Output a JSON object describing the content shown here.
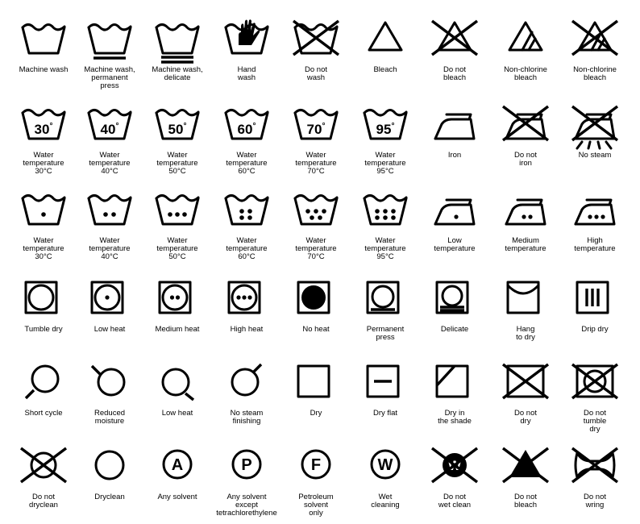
{
  "symbols": [
    {
      "icon": "machine-wash-icon",
      "label": "Machine wash"
    },
    {
      "icon": "machine-wash-permanent-press-icon",
      "label": "Machine wash,\npermanent\npress"
    },
    {
      "icon": "machine-wash-delicate-icon",
      "label": "Machine wash,\ndelicate"
    },
    {
      "icon": "hand-wash-icon",
      "label": "Hand\nwash"
    },
    {
      "icon": "do-not-wash-icon",
      "label": "Do not\nwash"
    },
    {
      "icon": "bleach-icon",
      "label": "Bleach"
    },
    {
      "icon": "do-not-bleach-icon",
      "label": "Do not\nbleach"
    },
    {
      "icon": "non-chlorine-bleach-icon",
      "label": "Non-chlorine\nbleach"
    },
    {
      "icon": "no-non-chlorine-bleach-icon",
      "label": "Non-chlorine\nbleach"
    },
    {
      "icon": "wash-30-icon",
      "label": "Water\ntemperature\n30°C",
      "temp": "30"
    },
    {
      "icon": "wash-40-icon",
      "label": "Water\ntemperature\n40°C",
      "temp": "40"
    },
    {
      "icon": "wash-50-icon",
      "label": "Water\ntemperature\n50°C",
      "temp": "50"
    },
    {
      "icon": "wash-60-icon",
      "label": "Water\ntemperature\n60°C",
      "temp": "60"
    },
    {
      "icon": "wash-70-icon",
      "label": "Water\ntemperature\n70°C",
      "temp": "70"
    },
    {
      "icon": "wash-95-icon",
      "label": "Water\ntemperature\n95°C",
      "temp": "95"
    },
    {
      "icon": "iron-icon",
      "label": "Iron"
    },
    {
      "icon": "do-not-iron-icon",
      "label": "Do not\niron"
    },
    {
      "icon": "no-steam-icon",
      "label": "No steam"
    },
    {
      "icon": "wash-one-dot-icon",
      "label": "Water\ntemperature\n30°C",
      "dots": 1
    },
    {
      "icon": "wash-two-dots-icon",
      "label": "Water\ntemperature\n40°C",
      "dots": 2
    },
    {
      "icon": "wash-three-dots-icon",
      "label": "Water\ntemperature\n50°C",
      "dots": 3
    },
    {
      "icon": "wash-four-dots-icon",
      "label": "Water\ntemperature\n60°C",
      "dots": 4
    },
    {
      "icon": "wash-five-dots-icon",
      "label": "Water\ntemperature\n70°C",
      "dots": 5
    },
    {
      "icon": "wash-six-dots-icon",
      "label": "Water\ntemperature\n95°C",
      "dots": 6
    },
    {
      "icon": "iron-low-icon",
      "label": "Low\ntemperature",
      "dots": 1
    },
    {
      "icon": "iron-medium-icon",
      "label": "Medium\ntemperature",
      "dots": 2
    },
    {
      "icon": "iron-high-icon",
      "label": "High\ntemperature",
      "dots": 3
    },
    {
      "icon": "tumble-dry-icon",
      "label": "Tumble dry"
    },
    {
      "icon": "tumble-dry-low-heat-icon",
      "label": "Low heat",
      "dots": 1
    },
    {
      "icon": "tumble-dry-medium-heat-icon",
      "label": "Medium heat",
      "dots": 2
    },
    {
      "icon": "tumble-dry-high-heat-icon",
      "label": "High heat",
      "dots": 3
    },
    {
      "icon": "tumble-dry-no-heat-icon",
      "label": "No heat"
    },
    {
      "icon": "tumble-dry-permanent-press-icon",
      "label": "Permanent\npress"
    },
    {
      "icon": "tumble-dry-delicate-icon",
      "label": "Delicate"
    },
    {
      "icon": "hang-to-dry-icon",
      "label": "Hang\nto dry"
    },
    {
      "icon": "drip-dry-icon",
      "label": "Drip dry"
    },
    {
      "icon": "short-cycle-icon",
      "label": "Short cycle"
    },
    {
      "icon": "reduced-moisture-icon",
      "label": "Reduced\nmoisture"
    },
    {
      "icon": "low-heat-circle-icon",
      "label": "Low heat"
    },
    {
      "icon": "no-steam-finishing-icon",
      "label": "No steam\nfinishing"
    },
    {
      "icon": "dry-icon",
      "label": "Dry"
    },
    {
      "icon": "dry-flat-icon",
      "label": "Dry flat"
    },
    {
      "icon": "dry-in-shade-icon",
      "label": "Dry in\nthe shade"
    },
    {
      "icon": "do-not-dry-icon",
      "label": "Do not\ndry"
    },
    {
      "icon": "do-not-tumble-dry-icon",
      "label": "Do not\ntumble\ndry"
    },
    {
      "icon": "do-not-dryclean-icon",
      "label": "Do not\ndryclean"
    },
    {
      "icon": "dryclean-icon",
      "label": "Dryclean"
    },
    {
      "icon": "any-solvent-icon",
      "label": "Any solvent",
      "letter": "A"
    },
    {
      "icon": "any-solvent-except-tce-icon",
      "label": "Any solvent\nexcept\ntetrachlorethylene",
      "letter": "P"
    },
    {
      "icon": "petroleum-solvent-icon",
      "label": "Petroleum\nsolvent\nonly",
      "letter": "F"
    },
    {
      "icon": "wet-cleaning-icon",
      "label": "Wet\ncleaning",
      "letter": "W"
    },
    {
      "icon": "do-not-wet-clean-icon",
      "label": "Do not\nwet clean"
    },
    {
      "icon": "do-not-bleach-filled-icon",
      "label": "Do not\nbleach"
    },
    {
      "icon": "do-not-wring-icon",
      "label": "Do not\nwring"
    }
  ]
}
